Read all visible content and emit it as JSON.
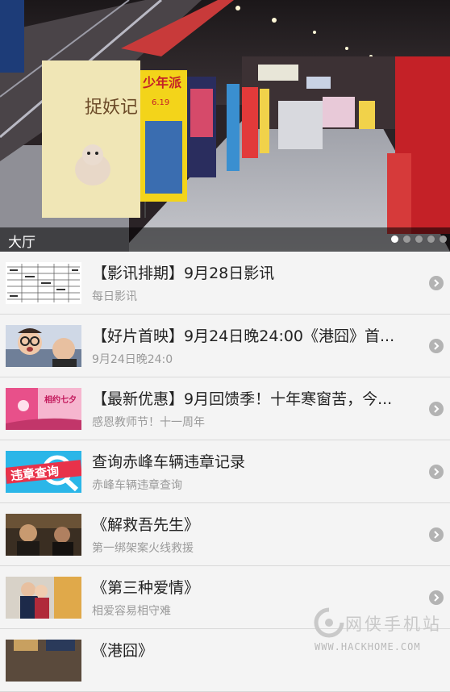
{
  "banner": {
    "caption": "大厅",
    "slide_count": 5,
    "active_slide": 1,
    "poster_left_title": "捉妖记",
    "poster_mid_title": "少年派",
    "poster_mid_date": "6.19"
  },
  "news": [
    {
      "title": "【影讯排期】9月28日影讯",
      "subtitle": "每日影讯",
      "thumb": "schedule-table"
    },
    {
      "title": "【好片首映】9月24日晚24:00《港囧》首...",
      "subtitle": "9月24日晚24:0",
      "thumb": "movie-still"
    },
    {
      "title": "【最新优惠】9月回馈季！十年寒窗苦，今...",
      "subtitle": "感恩教师节！十一周年",
      "thumb": "promo",
      "thumb_text": "相约七夕"
    },
    {
      "title": "查询赤峰车辆违章记录",
      "subtitle": "赤峰车辆违章查询",
      "thumb": "violation-query",
      "thumb_text": "违章查询"
    },
    {
      "title": "《解救吾先生》",
      "subtitle": "第一绑架案火线救援",
      "thumb": "movie-dark"
    },
    {
      "title": "《第三种爱情》",
      "subtitle": "相爱容易相守难",
      "thumb": "movie-couple"
    },
    {
      "title": "《港囧》",
      "subtitle": "",
      "thumb": "movie-partial"
    }
  ],
  "watermark": {
    "main": "网侠手机站",
    "sub": "WWW.HACKHOME.COM"
  },
  "colors": {
    "background": "#f2f2f2",
    "title_text": "#222222",
    "subtitle_text": "#9a9a9a",
    "chevron": "#b3b3b3",
    "violation_thumb": "#2bb6e8",
    "promo_thumb": "#e8508a"
  }
}
